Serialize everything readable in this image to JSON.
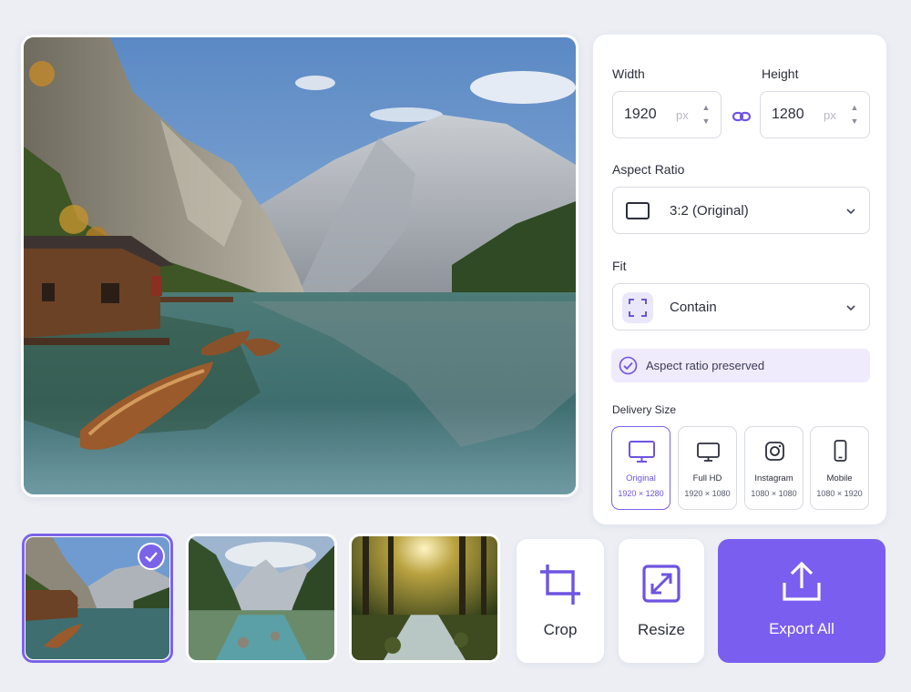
{
  "dimensions": {
    "width_label": "Width",
    "height_label": "Height",
    "width_value": "1920",
    "height_value": "1280",
    "unit": "px",
    "link_icon": "link-icon"
  },
  "aspect_ratio": {
    "label": "Aspect Ratio",
    "selected": "3:2 (Original)"
  },
  "fit": {
    "label": "Fit",
    "selected": "Contain"
  },
  "status": {
    "text": "Aspect ratio preserved"
  },
  "delivery": {
    "label": "Delivery Size",
    "options": [
      {
        "name": "Original",
        "dims": "1920 × 1280",
        "icon": "monitor-icon",
        "active": true
      },
      {
        "name": "Full HD",
        "dims": "1920 × 1080",
        "icon": "monitor-icon",
        "active": false
      },
      {
        "name": "Instagram",
        "dims": "1080 × 1080",
        "icon": "instagram-icon",
        "active": false
      },
      {
        "name": "Mobile",
        "dims": "1080 × 1920",
        "icon": "phone-icon",
        "active": false
      }
    ]
  },
  "thumbnails": [
    {
      "subject": "mountain lake with boathouse",
      "selected": true
    },
    {
      "subject": "alpine river valley",
      "selected": false
    },
    {
      "subject": "forest stream at sunrise",
      "selected": false
    }
  ],
  "tools": {
    "crop_label": "Crop",
    "resize_label": "Resize",
    "export_label": "Export All"
  },
  "colors": {
    "accent": "#7a5ef0",
    "accent_light": "#efebfc",
    "background": "#eceef4"
  }
}
